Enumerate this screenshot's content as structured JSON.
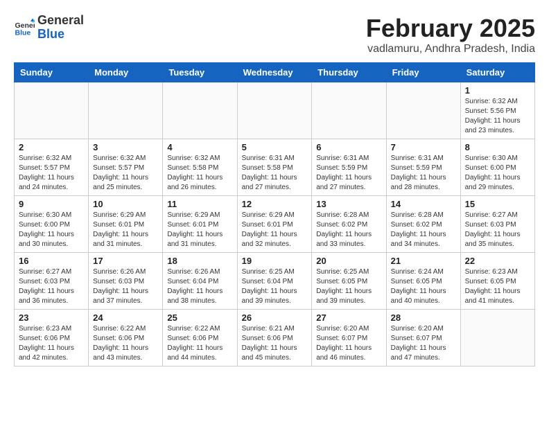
{
  "header": {
    "logo": {
      "general": "General",
      "blue": "Blue"
    },
    "title": "February 2025",
    "location": "vadlamuru, Andhra Pradesh, India"
  },
  "weekdays": [
    "Sunday",
    "Monday",
    "Tuesday",
    "Wednesday",
    "Thursday",
    "Friday",
    "Saturday"
  ],
  "weeks": [
    [
      {
        "day": null
      },
      {
        "day": null
      },
      {
        "day": null
      },
      {
        "day": null
      },
      {
        "day": null
      },
      {
        "day": null
      },
      {
        "day": 1,
        "sunrise": "6:32 AM",
        "sunset": "5:56 PM",
        "daylight": "11 hours and 23 minutes."
      }
    ],
    [
      {
        "day": 2,
        "sunrise": "6:32 AM",
        "sunset": "5:57 PM",
        "daylight": "11 hours and 24 minutes."
      },
      {
        "day": 3,
        "sunrise": "6:32 AM",
        "sunset": "5:57 PM",
        "daylight": "11 hours and 25 minutes."
      },
      {
        "day": 4,
        "sunrise": "6:32 AM",
        "sunset": "5:58 PM",
        "daylight": "11 hours and 26 minutes."
      },
      {
        "day": 5,
        "sunrise": "6:31 AM",
        "sunset": "5:58 PM",
        "daylight": "11 hours and 27 minutes."
      },
      {
        "day": 6,
        "sunrise": "6:31 AM",
        "sunset": "5:59 PM",
        "daylight": "11 hours and 27 minutes."
      },
      {
        "day": 7,
        "sunrise": "6:31 AM",
        "sunset": "5:59 PM",
        "daylight": "11 hours and 28 minutes."
      },
      {
        "day": 8,
        "sunrise": "6:30 AM",
        "sunset": "6:00 PM",
        "daylight": "11 hours and 29 minutes."
      }
    ],
    [
      {
        "day": 9,
        "sunrise": "6:30 AM",
        "sunset": "6:00 PM",
        "daylight": "11 hours and 30 minutes."
      },
      {
        "day": 10,
        "sunrise": "6:29 AM",
        "sunset": "6:01 PM",
        "daylight": "11 hours and 31 minutes."
      },
      {
        "day": 11,
        "sunrise": "6:29 AM",
        "sunset": "6:01 PM",
        "daylight": "11 hours and 31 minutes."
      },
      {
        "day": 12,
        "sunrise": "6:29 AM",
        "sunset": "6:01 PM",
        "daylight": "11 hours and 32 minutes."
      },
      {
        "day": 13,
        "sunrise": "6:28 AM",
        "sunset": "6:02 PM",
        "daylight": "11 hours and 33 minutes."
      },
      {
        "day": 14,
        "sunrise": "6:28 AM",
        "sunset": "6:02 PM",
        "daylight": "11 hours and 34 minutes."
      },
      {
        "day": 15,
        "sunrise": "6:27 AM",
        "sunset": "6:03 PM",
        "daylight": "11 hours and 35 minutes."
      }
    ],
    [
      {
        "day": 16,
        "sunrise": "6:27 AM",
        "sunset": "6:03 PM",
        "daylight": "11 hours and 36 minutes."
      },
      {
        "day": 17,
        "sunrise": "6:26 AM",
        "sunset": "6:03 PM",
        "daylight": "11 hours and 37 minutes."
      },
      {
        "day": 18,
        "sunrise": "6:26 AM",
        "sunset": "6:04 PM",
        "daylight": "11 hours and 38 minutes."
      },
      {
        "day": 19,
        "sunrise": "6:25 AM",
        "sunset": "6:04 PM",
        "daylight": "11 hours and 39 minutes."
      },
      {
        "day": 20,
        "sunrise": "6:25 AM",
        "sunset": "6:05 PM",
        "daylight": "11 hours and 39 minutes."
      },
      {
        "day": 21,
        "sunrise": "6:24 AM",
        "sunset": "6:05 PM",
        "daylight": "11 hours and 40 minutes."
      },
      {
        "day": 22,
        "sunrise": "6:23 AM",
        "sunset": "6:05 PM",
        "daylight": "11 hours and 41 minutes."
      }
    ],
    [
      {
        "day": 23,
        "sunrise": "6:23 AM",
        "sunset": "6:06 PM",
        "daylight": "11 hours and 42 minutes."
      },
      {
        "day": 24,
        "sunrise": "6:22 AM",
        "sunset": "6:06 PM",
        "daylight": "11 hours and 43 minutes."
      },
      {
        "day": 25,
        "sunrise": "6:22 AM",
        "sunset": "6:06 PM",
        "daylight": "11 hours and 44 minutes."
      },
      {
        "day": 26,
        "sunrise": "6:21 AM",
        "sunset": "6:06 PM",
        "daylight": "11 hours and 45 minutes."
      },
      {
        "day": 27,
        "sunrise": "6:20 AM",
        "sunset": "6:07 PM",
        "daylight": "11 hours and 46 minutes."
      },
      {
        "day": 28,
        "sunrise": "6:20 AM",
        "sunset": "6:07 PM",
        "daylight": "11 hours and 47 minutes."
      },
      {
        "day": null
      }
    ]
  ]
}
